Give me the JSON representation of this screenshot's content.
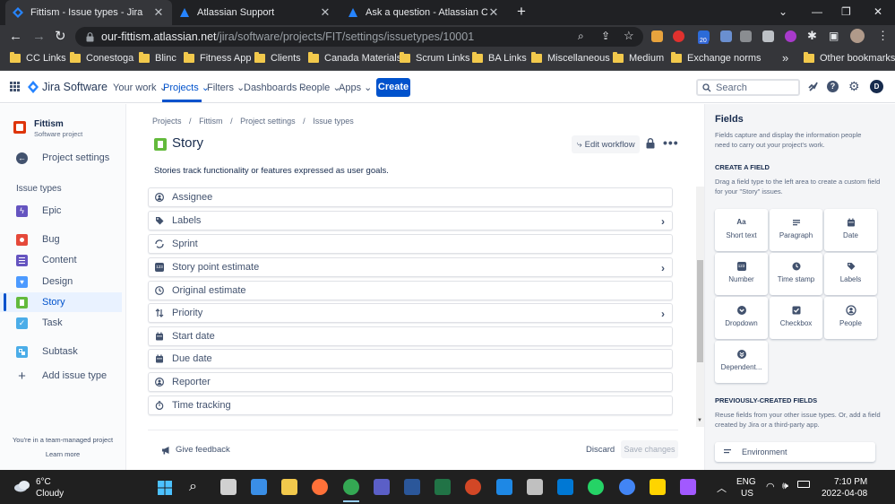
{
  "browser": {
    "tabs": [
      {
        "title": "Fittism - Issue types - Jira",
        "active": true
      },
      {
        "title": "Atlassian Support",
        "active": false
      },
      {
        "title": "Ask a question - Atlassian Comm",
        "active": false
      }
    ],
    "url": {
      "host": "our-fittism.atlassian.net",
      "path": "/jira/software/projects/FIT/settings/issuetypes/10001"
    },
    "extension_badge": "20",
    "profile_initial": "",
    "bookmarks": [
      "CC Links",
      "Conestoga",
      "Blinc",
      "Fitness App",
      "Clients",
      "Canada Materials",
      "Scrum Links",
      "BA Links",
      "Miscellaneous",
      "Medium",
      "Exchange norms"
    ],
    "overflow": "»",
    "other_bookmarks": "Other bookmarks"
  },
  "jira_nav": {
    "logo": "Jira Software",
    "items": [
      {
        "label": "Your work",
        "active": false
      },
      {
        "label": "Projects",
        "active": true
      },
      {
        "label": "Filters",
        "active": false
      },
      {
        "label": "Dashboards",
        "active": false
      },
      {
        "label": "People",
        "active": false
      },
      {
        "label": "Apps",
        "active": false
      }
    ],
    "create": "Create",
    "search_placeholder": "Search",
    "avatar_initial": "D"
  },
  "sidebar": {
    "project_name": "Fittism",
    "project_type": "Software project",
    "project_settings": "Project settings",
    "section_title": "Issue types",
    "items": [
      {
        "label": "Epic",
        "color": "#6554c0",
        "selected": false
      },
      {
        "label": "Bug",
        "color": "#e5493a",
        "selected": false
      },
      {
        "label": "Content",
        "color": "#6554c0",
        "selected": false
      },
      {
        "label": "Design",
        "color": "#4c9aff",
        "selected": false
      },
      {
        "label": "Story",
        "color": "#63ba3c",
        "selected": true
      },
      {
        "label": "Task",
        "color": "#4bade8",
        "selected": false
      },
      {
        "label": "Subtask",
        "color": "#4bade8",
        "selected": false
      }
    ],
    "add_issue_type": "Add issue type",
    "footer": "You're in a team-managed project",
    "learn_more": "Learn more"
  },
  "main": {
    "breadcrumbs": [
      "Projects",
      "Fittism",
      "Project settings",
      "Issue types"
    ],
    "title": "Story",
    "edit_workflow": "Edit workflow",
    "description": "Stories track functionality or features expressed as user goals.",
    "fields": [
      {
        "label": "Assignee",
        "icon": "person-icon",
        "chevron": false
      },
      {
        "label": "Labels",
        "icon": "tag-icon",
        "chevron": true
      },
      {
        "label": "Sprint",
        "icon": "sprint-icon",
        "chevron": false
      },
      {
        "label": "Story point estimate",
        "icon": "number-icon",
        "chevron": true
      },
      {
        "label": "Original estimate",
        "icon": "clock-icon",
        "chevron": false
      },
      {
        "label": "Priority",
        "icon": "priority-icon",
        "chevron": true
      },
      {
        "label": "Start date",
        "icon": "calendar-icon",
        "chevron": false
      },
      {
        "label": "Due date",
        "icon": "calendar-icon",
        "chevron": false
      },
      {
        "label": "Reporter",
        "icon": "person-icon",
        "chevron": false
      },
      {
        "label": "Time tracking",
        "icon": "stopwatch-icon",
        "chevron": false
      }
    ],
    "give_feedback": "Give feedback",
    "discard": "Discard",
    "save_changes": "Save changes"
  },
  "right_panel": {
    "title": "Fields",
    "description": "Fields capture and display the information people need to carry out your project's work.",
    "create_heading": "CREATE A FIELD",
    "create_description": "Drag a field type to the left area to create a custom field for your \"Story\" issues.",
    "field_types": [
      {
        "label": "Short text",
        "icon": "text-icon"
      },
      {
        "label": "Paragraph",
        "icon": "paragraph-icon"
      },
      {
        "label": "Date",
        "icon": "calendar-icon"
      },
      {
        "label": "Number",
        "icon": "number-icon"
      },
      {
        "label": "Time stamp",
        "icon": "clock-icon"
      },
      {
        "label": "Labels",
        "icon": "tag-icon"
      },
      {
        "label": "Dropdown",
        "icon": "dropdown-icon"
      },
      {
        "label": "Checkbox",
        "icon": "checkbox-icon"
      },
      {
        "label": "People",
        "icon": "person-icon"
      },
      {
        "label": "Dependent...",
        "icon": "dependent-icon"
      }
    ],
    "previous_heading": "PREVIOUSLY-CREATED FIELDS",
    "previous_description": "Reuse fields from your other issue types. Or, add a field created by Jira or a third-party app.",
    "previous_fields": [
      {
        "label": "Environment"
      }
    ]
  },
  "taskbar": {
    "weather_temp": "6°C",
    "weather_desc": "Cloudy",
    "language": "ENG",
    "region": "US",
    "time": "7:10 PM",
    "date": "2022-04-08"
  }
}
